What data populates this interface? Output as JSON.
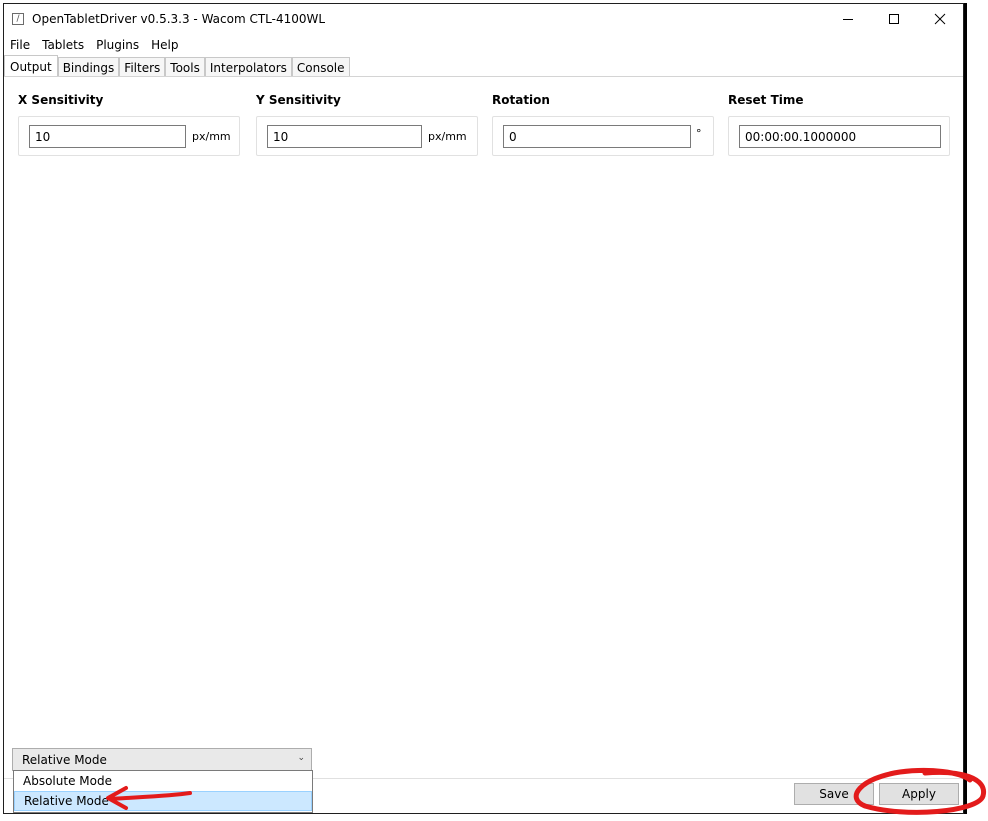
{
  "window": {
    "title": "OpenTabletDriver v0.5.3.3 - Wacom CTL-4100WL",
    "app_icon_glyph": "/"
  },
  "menu": [
    "File",
    "Tablets",
    "Plugins",
    "Help"
  ],
  "tabs": [
    {
      "label": "Output",
      "active": true
    },
    {
      "label": "Bindings",
      "active": false
    },
    {
      "label": "Filters",
      "active": false
    },
    {
      "label": "Tools",
      "active": false
    },
    {
      "label": "Interpolators",
      "active": false
    },
    {
      "label": "Console",
      "active": false
    }
  ],
  "settings": {
    "x_sensitivity": {
      "label": "X Sensitivity",
      "value": "10",
      "unit": "px/mm"
    },
    "y_sensitivity": {
      "label": "Y Sensitivity",
      "value": "10",
      "unit": "px/mm"
    },
    "rotation": {
      "label": "Rotation",
      "value": "0",
      "unit": "°"
    },
    "reset_time": {
      "label": "Reset Time",
      "value": "00:00:00.1000000"
    }
  },
  "mode": {
    "selected": "Relative Mode",
    "options": [
      "Absolute Mode",
      "Relative Mode"
    ],
    "highlighted_index": 1
  },
  "buttons": {
    "save": "Save",
    "apply": "Apply"
  },
  "annotation_color": "#e31b1b"
}
